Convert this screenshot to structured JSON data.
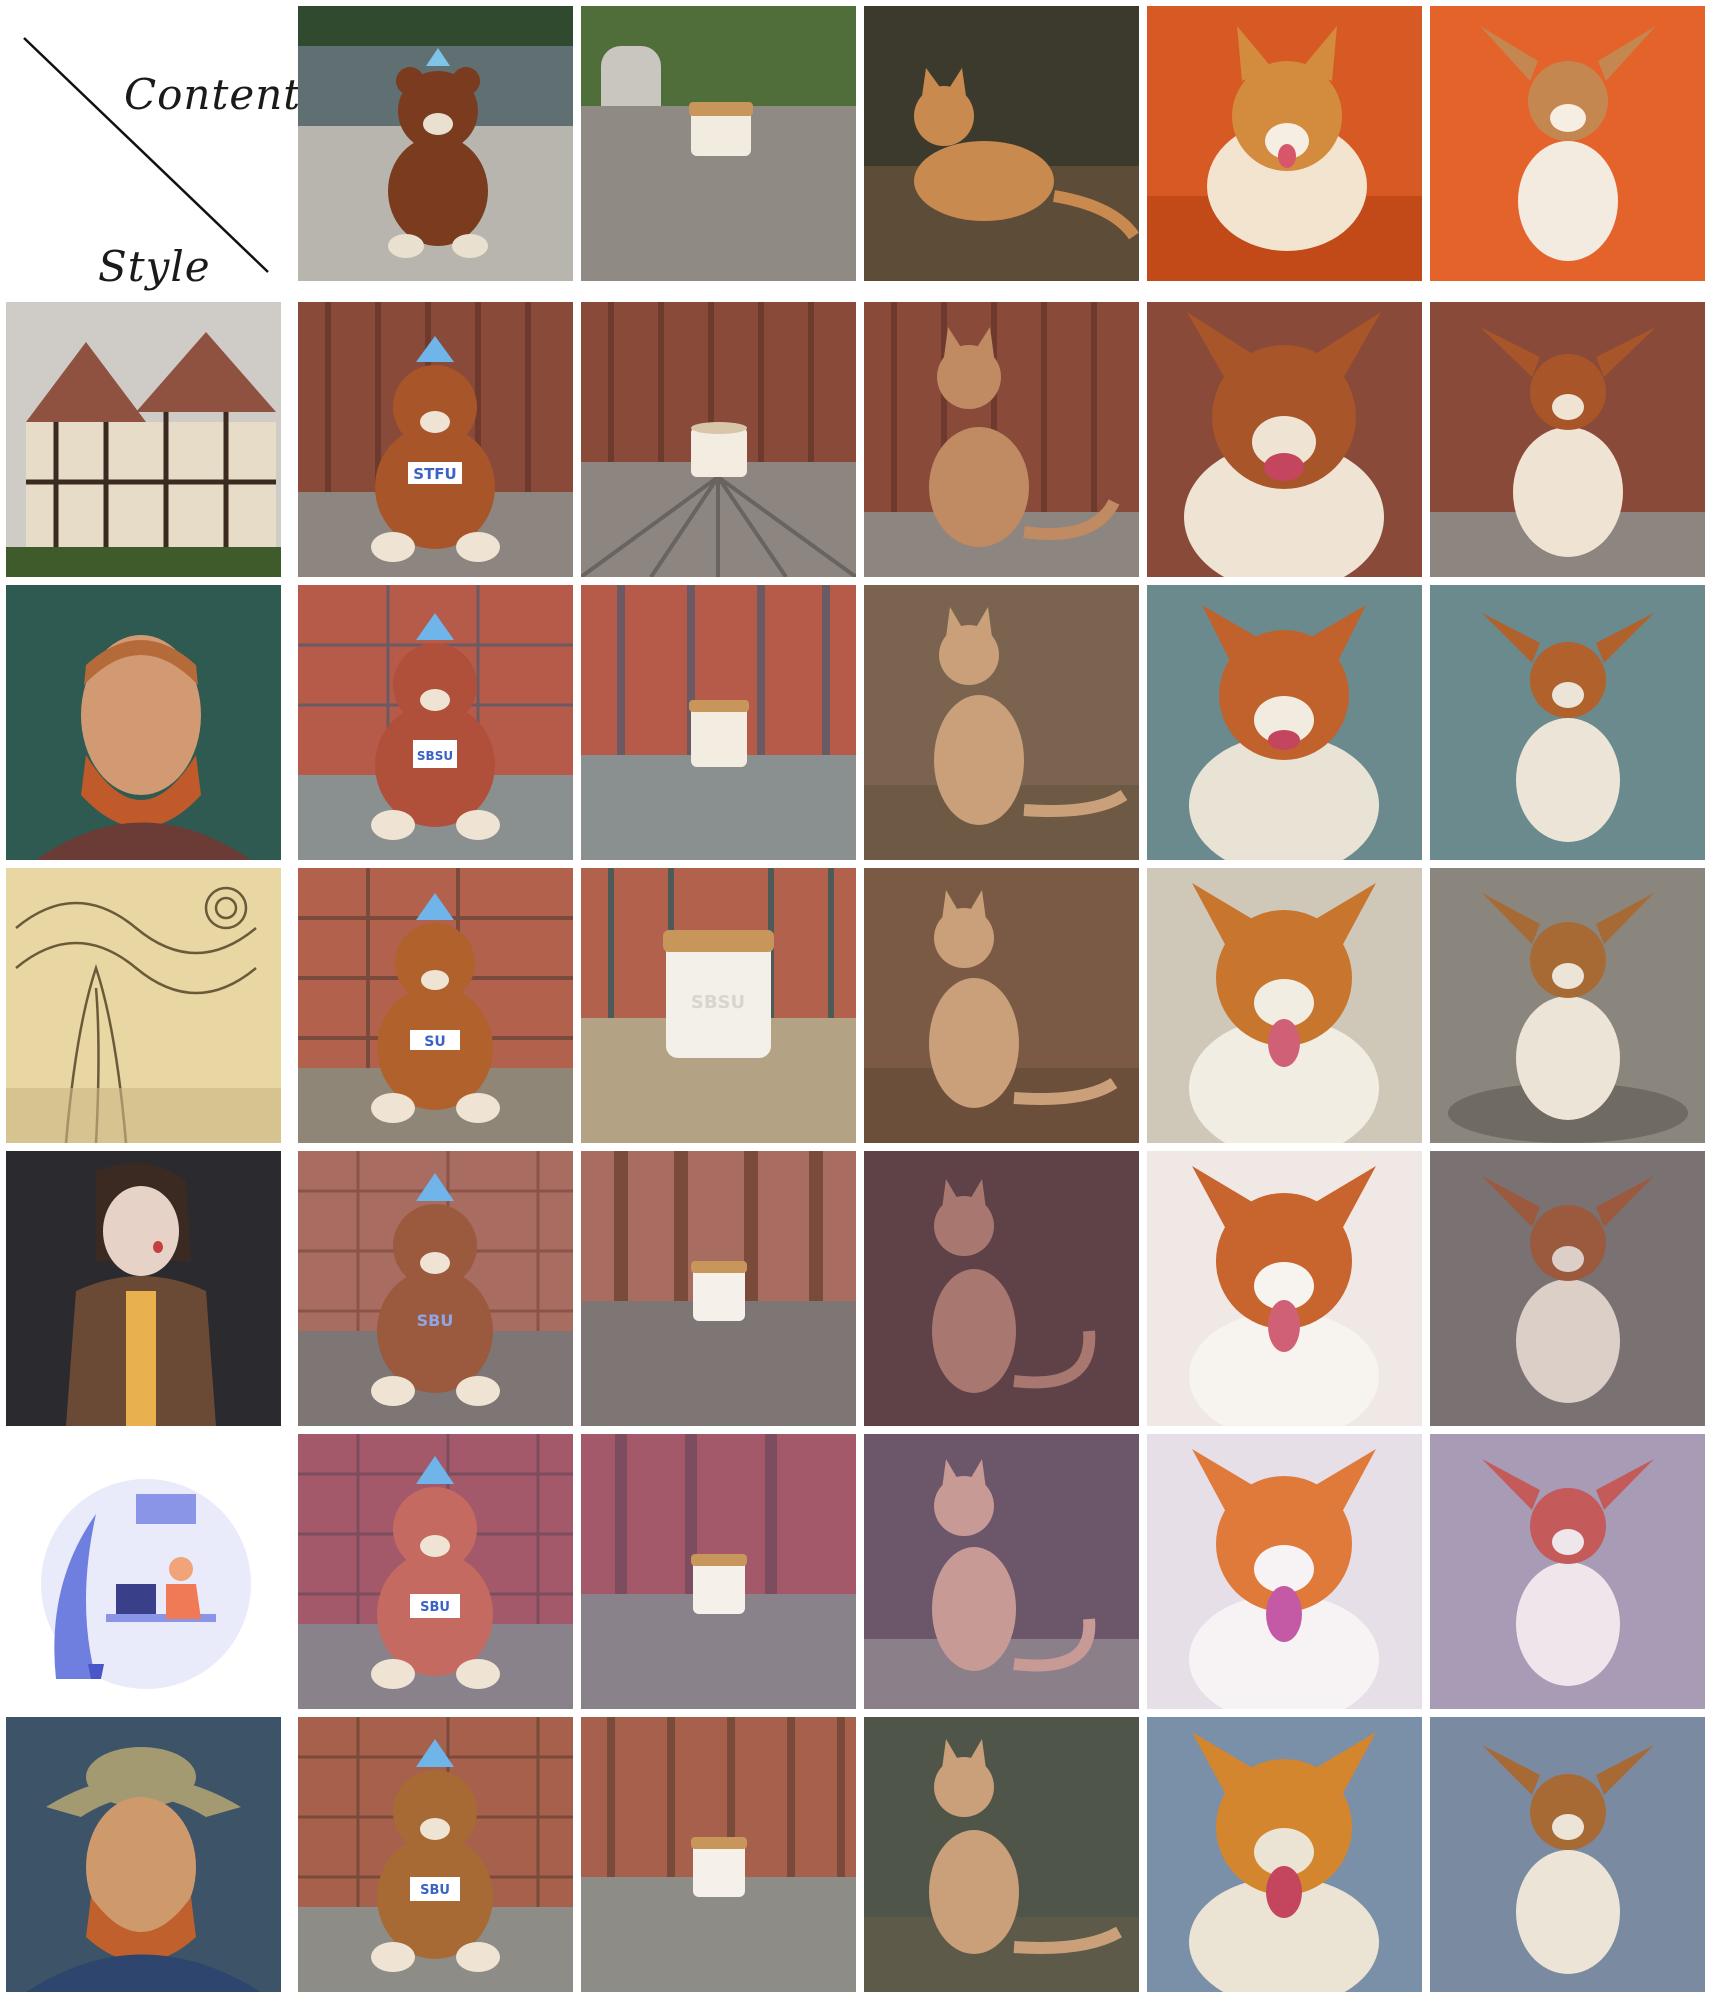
{
  "header": {
    "content_label": "Content",
    "style_label": "Style"
  },
  "content_images": [
    {
      "subject": "teddy-bear",
      "scene": "riverside"
    },
    {
      "subject": "candle-jar",
      "scene": "rock"
    },
    {
      "subject": "cat",
      "scene": "garden"
    },
    {
      "subject": "corgi",
      "scene": "orange-backdrop"
    },
    {
      "subject": "puppy",
      "scene": "orange-backdrop"
    }
  ],
  "style_images": [
    {
      "style": "tudor-house-painting"
    },
    {
      "style": "pointillist-self-portrait"
    },
    {
      "style": "starry-swirl-sketch"
    },
    {
      "style": "3d-character-render"
    },
    {
      "style": "flat-vector-illustration"
    },
    {
      "style": "impressionist-hat-portrait"
    }
  ],
  "result_labels": {
    "teddy_bear": [
      "STFU",
      "SBSU",
      "SU",
      "SBU",
      "SBU",
      "SBU"
    ],
    "candle_jar": [
      "",
      "",
      "SBSU",
      "",
      "",
      ""
    ]
  },
  "colors": {
    "row_palettes": [
      {
        "bg": "#8a4a3a",
        "stripe": "#6e3a2d",
        "floor": "#8c8580",
        "subject": "#a8552a"
      },
      {
        "bg": "#b65a4a",
        "stripe": "#6b5a64",
        "floor": "#8a8f8f",
        "subject": "#b0503b"
      },
      {
        "bg": "#b2614d",
        "stripe": "#7a4a3c",
        "floor": "#8f8677",
        "subject": "#b0612c"
      },
      {
        "bg": "#a86d60",
        "stripe": "#8a5548",
        "floor": "#7d7675",
        "subject": "#9b5a3d"
      },
      {
        "bg": "#a3596a",
        "stripe": "#7c4d5e",
        "floor": "#8a828a",
        "subject": "#c46a60"
      },
      {
        "bg": "#a6604c",
        "stripe": "#7a4b3b",
        "floor": "#8e8c86",
        "subject": "#a86a35"
      }
    ]
  }
}
